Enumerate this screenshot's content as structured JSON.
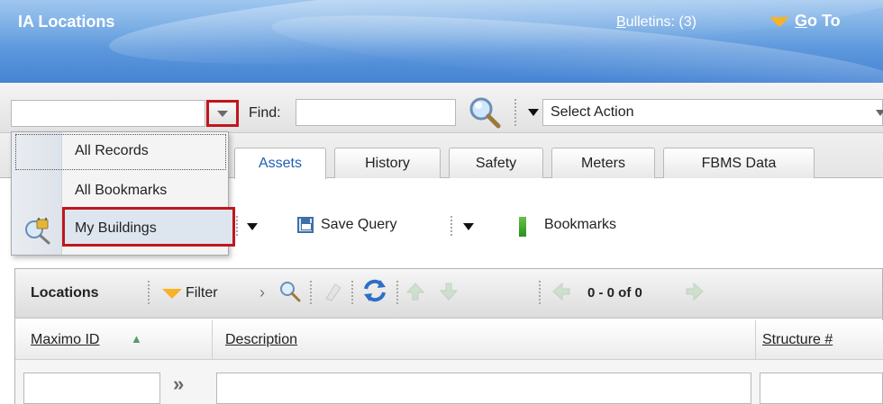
{
  "header": {
    "app_title": "IA Locations",
    "bulletins_prefix": "B",
    "bulletins_rest": "ulletins: (3)",
    "goto_prefix": "G",
    "goto_rest": "o To"
  },
  "toolbar": {
    "find_label": "Find:",
    "find_value": "",
    "query_value": "",
    "select_action_label": "Select Action"
  },
  "query_menu": {
    "items": [
      {
        "label": "All Records"
      },
      {
        "label": "All Bookmarks"
      },
      {
        "label": "My Buildings"
      }
    ]
  },
  "tabs": [
    {
      "label": "Assets",
      "active": true
    },
    {
      "label": "History",
      "active": false
    },
    {
      "label": "Safety",
      "active": false
    },
    {
      "label": "Meters",
      "active": false
    },
    {
      "label": "FBMS Data",
      "active": false
    }
  ],
  "actions": {
    "save_query_label": "Save Query",
    "bookmarks_label": "Bookmarks"
  },
  "table": {
    "title": "Locations",
    "filter_label": "Filter",
    "pager_text": "0 - 0 of 0",
    "columns": [
      {
        "label": "Maximo ID"
      },
      {
        "label": "Description"
      },
      {
        "label": "Structure #"
      }
    ]
  },
  "colors": {
    "accent_red": "#c0161c",
    "header_blue": "#5c97dc",
    "orange": "#f7b227",
    "tab_active_text": "#1d5fb4"
  }
}
